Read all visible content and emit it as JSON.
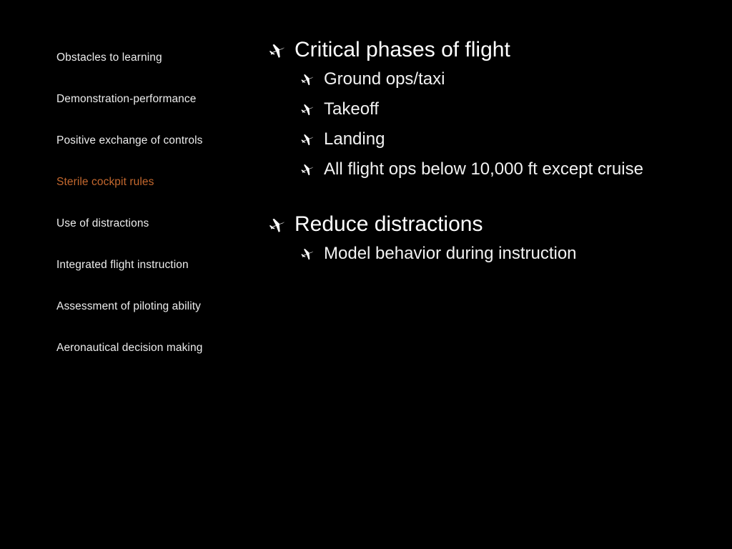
{
  "slide": {
    "background_color": "#000000",
    "text_color": "#FFFFFF",
    "highlight_color": "#C4682E",
    "nav_text_color": "#ECECEC",
    "bullet_icon": "airplane-icon"
  },
  "nav": {
    "items": [
      {
        "label": "Obstacles to learning",
        "current": false
      },
      {
        "label": "Demonstration-performance",
        "current": false
      },
      {
        "label": "Positive exchange of controls",
        "current": false
      },
      {
        "label": "Sterile cockpit rules",
        "current": true
      },
      {
        "label": "Use of distractions",
        "current": false
      },
      {
        "label": "Integrated flight instruction",
        "current": false
      },
      {
        "label": "Assessment of piloting ability",
        "current": false
      },
      {
        "label": "Aeronautical decision making",
        "current": false
      }
    ]
  },
  "content": {
    "blocks": [
      {
        "heading": "Critical phases of flight",
        "subitems": [
          "Ground ops/taxi",
          "Takeoff",
          "Landing",
          "All flight ops below 10,000 ft except cruise"
        ]
      },
      {
        "heading": "Reduce distractions",
        "subitems": [
          "Model behavior during instruction"
        ]
      }
    ]
  }
}
